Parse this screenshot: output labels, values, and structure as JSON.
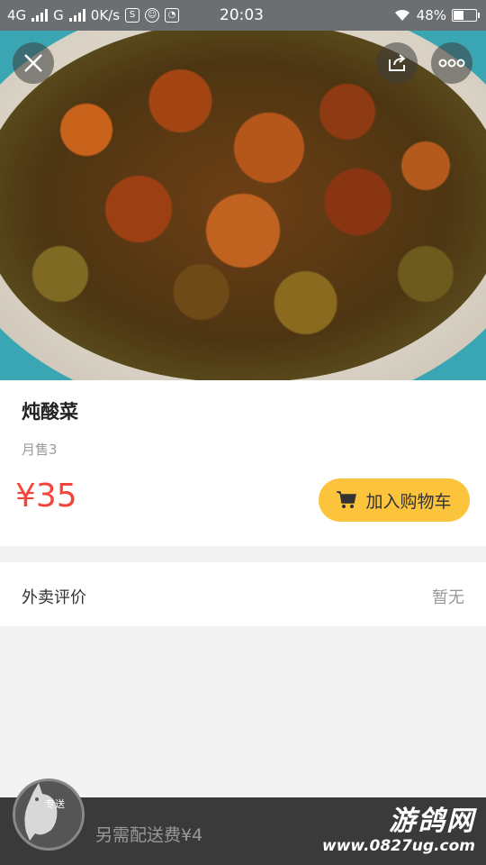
{
  "status_bar": {
    "net1": "4G",
    "net2": "G",
    "speed": "0K/s",
    "time": "20:03",
    "battery": "48%",
    "battery_level": 0.48
  },
  "hero": {
    "close_icon": "close-icon",
    "share_icon": "share-icon",
    "more_icon": "more-icon"
  },
  "dish": {
    "name": "炖酸菜",
    "sold": "月售3",
    "price": "¥35",
    "add_to_cart_label": "加入购物车"
  },
  "reviews": {
    "label": "外卖评价",
    "value": "暂无"
  },
  "bottom_bar": {
    "badge_tag": "专送",
    "delivery_fee": "另需配送费¥4",
    "watermark_main": "游鸽网",
    "watermark_url": "www.0827ug.com"
  },
  "colors": {
    "price": "#f5453a",
    "cart_button": "#fcc43d",
    "bottom_bar": "#3a3a3a"
  }
}
